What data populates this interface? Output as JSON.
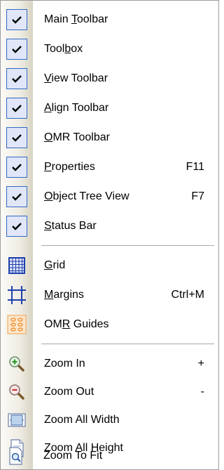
{
  "menu": {
    "items": [
      {
        "before": "Main ",
        "accel": "T",
        "after": "oolbar",
        "shortcut": "",
        "checked": true,
        "icon": "check-icon"
      },
      {
        "before": "Tool",
        "accel": "b",
        "after": "ox",
        "shortcut": "",
        "checked": true,
        "icon": "check-icon"
      },
      {
        "before": "",
        "accel": "V",
        "after": "iew Toolbar",
        "shortcut": "",
        "checked": true,
        "icon": "check-icon"
      },
      {
        "before": "",
        "accel": "A",
        "after": "lign Toolbar",
        "shortcut": "",
        "checked": true,
        "icon": "check-icon"
      },
      {
        "before": "",
        "accel": "O",
        "after": "MR Toolbar",
        "shortcut": "",
        "checked": true,
        "icon": "check-icon"
      },
      {
        "before": "",
        "accel": "P",
        "after": "roperties",
        "shortcut": "F11",
        "checked": true,
        "icon": "check-icon"
      },
      {
        "before": "",
        "accel": "O",
        "after": "bject Tree View",
        "shortcut": "F7",
        "checked": true,
        "icon": "check-icon"
      },
      {
        "before": "",
        "accel": "S",
        "after": "tatus Bar",
        "shortcut": "",
        "checked": true,
        "icon": "check-icon"
      },
      {
        "before": "",
        "accel": "G",
        "after": "rid",
        "shortcut": "",
        "checked": false,
        "icon": "grid-icon"
      },
      {
        "before": "",
        "accel": "M",
        "after": "argins",
        "shortcut": "Ctrl+M",
        "checked": false,
        "icon": "margins-icon"
      },
      {
        "before": "OM",
        "accel": "R",
        "after": " Guides",
        "shortcut": "",
        "checked": false,
        "icon": "omr-guides-icon"
      },
      {
        "before": "Zoom In",
        "accel": "",
        "after": "",
        "shortcut": "+",
        "checked": false,
        "icon": "zoom-in-icon"
      },
      {
        "before": "Zoom Out",
        "accel": "",
        "after": "",
        "shortcut": "-",
        "checked": false,
        "icon": "zoom-out-icon"
      },
      {
        "before": "Zoom All Width",
        "accel": "",
        "after": "",
        "shortcut": "",
        "checked": false,
        "icon": "zoom-all-width-icon"
      },
      {
        "before": "Zoom All Height",
        "accel": "",
        "after": "",
        "shortcut": "",
        "checked": false,
        "icon": "zoom-all-height-icon"
      },
      {
        "before": "Zoom To Fit",
        "accel": "",
        "after": "",
        "shortcut": "",
        "checked": false,
        "icon": "zoom-to-fit-icon"
      }
    ]
  },
  "colors": {
    "check_highlight": "#e1e6f8",
    "check_border": "#316ac5",
    "icon_blue": "#1f3fae",
    "zoom_green": "#2e9a2e",
    "zoom_red": "#d03030"
  }
}
